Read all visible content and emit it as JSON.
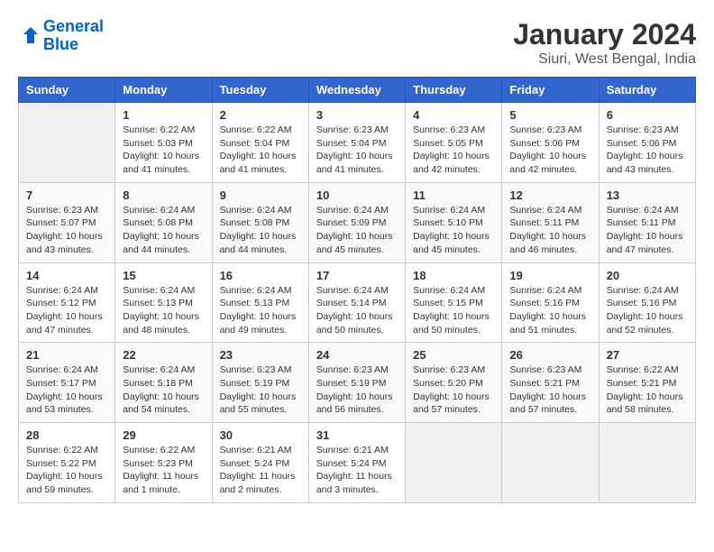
{
  "header": {
    "logo_line1": "General",
    "logo_line2": "Blue",
    "title": "January 2024",
    "subtitle": "Siuri, West Bengal, India"
  },
  "columns": [
    "Sunday",
    "Monday",
    "Tuesday",
    "Wednesday",
    "Thursday",
    "Friday",
    "Saturday"
  ],
  "weeks": [
    [
      {
        "day": "",
        "empty": true
      },
      {
        "day": "1",
        "sunrise": "6:22 AM",
        "sunset": "5:03 PM",
        "daylight": "10 hours and 41 minutes."
      },
      {
        "day": "2",
        "sunrise": "6:22 AM",
        "sunset": "5:04 PM",
        "daylight": "10 hours and 41 minutes."
      },
      {
        "day": "3",
        "sunrise": "6:23 AM",
        "sunset": "5:04 PM",
        "daylight": "10 hours and 41 minutes."
      },
      {
        "day": "4",
        "sunrise": "6:23 AM",
        "sunset": "5:05 PM",
        "daylight": "10 hours and 42 minutes."
      },
      {
        "day": "5",
        "sunrise": "6:23 AM",
        "sunset": "5:06 PM",
        "daylight": "10 hours and 42 minutes."
      },
      {
        "day": "6",
        "sunrise": "6:23 AM",
        "sunset": "5:06 PM",
        "daylight": "10 hours and 43 minutes."
      }
    ],
    [
      {
        "day": "7",
        "sunrise": "6:23 AM",
        "sunset": "5:07 PM",
        "daylight": "10 hours and 43 minutes."
      },
      {
        "day": "8",
        "sunrise": "6:24 AM",
        "sunset": "5:08 PM",
        "daylight": "10 hours and 44 minutes."
      },
      {
        "day": "9",
        "sunrise": "6:24 AM",
        "sunset": "5:08 PM",
        "daylight": "10 hours and 44 minutes."
      },
      {
        "day": "10",
        "sunrise": "6:24 AM",
        "sunset": "5:09 PM",
        "daylight": "10 hours and 45 minutes."
      },
      {
        "day": "11",
        "sunrise": "6:24 AM",
        "sunset": "5:10 PM",
        "daylight": "10 hours and 45 minutes."
      },
      {
        "day": "12",
        "sunrise": "6:24 AM",
        "sunset": "5:11 PM",
        "daylight": "10 hours and 46 minutes."
      },
      {
        "day": "13",
        "sunrise": "6:24 AM",
        "sunset": "5:11 PM",
        "daylight": "10 hours and 47 minutes."
      }
    ],
    [
      {
        "day": "14",
        "sunrise": "6:24 AM",
        "sunset": "5:12 PM",
        "daylight": "10 hours and 47 minutes."
      },
      {
        "day": "15",
        "sunrise": "6:24 AM",
        "sunset": "5:13 PM",
        "daylight": "10 hours and 48 minutes."
      },
      {
        "day": "16",
        "sunrise": "6:24 AM",
        "sunset": "5:13 PM",
        "daylight": "10 hours and 49 minutes."
      },
      {
        "day": "17",
        "sunrise": "6:24 AM",
        "sunset": "5:14 PM",
        "daylight": "10 hours and 50 minutes."
      },
      {
        "day": "18",
        "sunrise": "6:24 AM",
        "sunset": "5:15 PM",
        "daylight": "10 hours and 50 minutes."
      },
      {
        "day": "19",
        "sunrise": "6:24 AM",
        "sunset": "5:16 PM",
        "daylight": "10 hours and 51 minutes."
      },
      {
        "day": "20",
        "sunrise": "6:24 AM",
        "sunset": "5:16 PM",
        "daylight": "10 hours and 52 minutes."
      }
    ],
    [
      {
        "day": "21",
        "sunrise": "6:24 AM",
        "sunset": "5:17 PM",
        "daylight": "10 hours and 53 minutes."
      },
      {
        "day": "22",
        "sunrise": "6:24 AM",
        "sunset": "5:18 PM",
        "daylight": "10 hours and 54 minutes."
      },
      {
        "day": "23",
        "sunrise": "6:23 AM",
        "sunset": "5:19 PM",
        "daylight": "10 hours and 55 minutes."
      },
      {
        "day": "24",
        "sunrise": "6:23 AM",
        "sunset": "5:19 PM",
        "daylight": "10 hours and 56 minutes."
      },
      {
        "day": "25",
        "sunrise": "6:23 AM",
        "sunset": "5:20 PM",
        "daylight": "10 hours and 57 minutes."
      },
      {
        "day": "26",
        "sunrise": "6:23 AM",
        "sunset": "5:21 PM",
        "daylight": "10 hours and 57 minutes."
      },
      {
        "day": "27",
        "sunrise": "6:22 AM",
        "sunset": "5:21 PM",
        "daylight": "10 hours and 58 minutes."
      }
    ],
    [
      {
        "day": "28",
        "sunrise": "6:22 AM",
        "sunset": "5:22 PM",
        "daylight": "10 hours and 59 minutes."
      },
      {
        "day": "29",
        "sunrise": "6:22 AM",
        "sunset": "5:23 PM",
        "daylight": "11 hours and 1 minute."
      },
      {
        "day": "30",
        "sunrise": "6:21 AM",
        "sunset": "5:24 PM",
        "daylight": "11 hours and 2 minutes."
      },
      {
        "day": "31",
        "sunrise": "6:21 AM",
        "sunset": "5:24 PM",
        "daylight": "11 hours and 3 minutes."
      },
      {
        "day": "",
        "empty": true
      },
      {
        "day": "",
        "empty": true
      },
      {
        "day": "",
        "empty": true
      }
    ]
  ]
}
